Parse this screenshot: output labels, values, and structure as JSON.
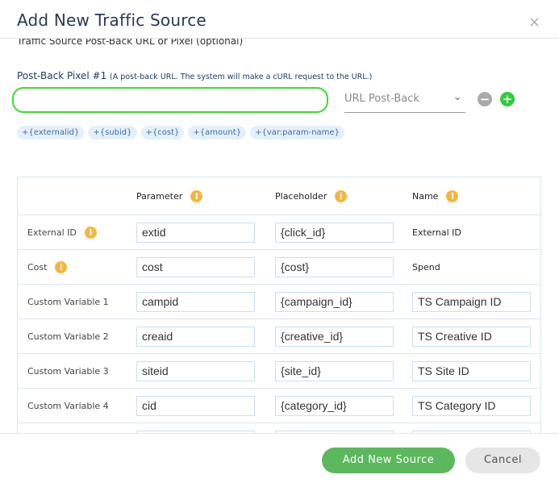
{
  "modal": {
    "title": "Add New Traffic Source",
    "close": "×"
  },
  "clipped_label": "Traffic Source Post-Back URL or Pixel (optional)",
  "postback": {
    "label": "Post-Back Pixel #1",
    "hint": "(A post-back URL. The system will make a cURL request to the URL.)",
    "value": "",
    "select_value": "URL Post-Back",
    "remove": "−",
    "add": "+"
  },
  "tags": [
    "+{externalid}",
    "+{subid}",
    "+{cost}",
    "+{amount}",
    "+{var:param-name}"
  ],
  "table": {
    "headers": {
      "parameter": "Parameter",
      "placeholder": "Placeholder",
      "name": "Name"
    },
    "rows": [
      {
        "label": "External ID",
        "info": true,
        "parameter": "extid",
        "placeholder": "{click_id}",
        "name": "External ID",
        "name_editable": false
      },
      {
        "label": "Cost",
        "info": true,
        "parameter": "cost",
        "placeholder": "{cost}",
        "name": "Spend",
        "name_editable": false
      },
      {
        "label": "Custom Variable 1",
        "info": false,
        "parameter": "campid",
        "placeholder": "{campaign_id}",
        "name": "TS Campaign ID",
        "name_editable": true
      },
      {
        "label": "Custom Variable 2",
        "info": false,
        "parameter": "creaid",
        "placeholder": "{creative_id}",
        "name": "TS Creative ID",
        "name_editable": true
      },
      {
        "label": "Custom Variable 3",
        "info": false,
        "parameter": "siteid",
        "placeholder": "{site_id}",
        "name": "TS Site ID",
        "name_editable": true
      },
      {
        "label": "Custom Variable 4",
        "info": false,
        "parameter": "cid",
        "placeholder": "{category_id}",
        "name": "TS Category ID",
        "name_editable": true
      },
      {
        "label": "",
        "info": false,
        "parameter": "",
        "placeholder": "",
        "name": "",
        "name_editable": true
      }
    ]
  },
  "footer": {
    "submit": "Add New Source",
    "cancel": "Cancel"
  },
  "colors": {
    "accent": "#5cb85c",
    "focus": "#3ddc2f",
    "info": "#f5b53d",
    "tag_bg": "#e5f0fb"
  }
}
